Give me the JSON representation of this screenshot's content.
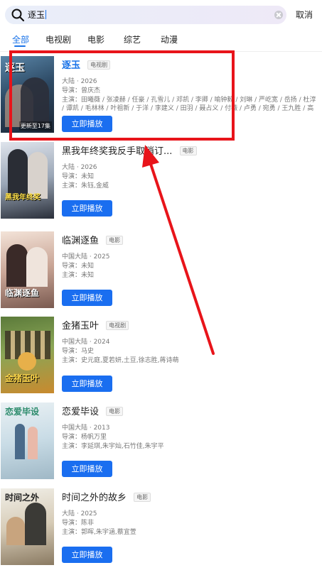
{
  "search": {
    "query": "逐玉",
    "cancel_label": "取消"
  },
  "tabs": [
    {
      "label": "全部"
    },
    {
      "label": "电视剧"
    },
    {
      "label": "电影"
    },
    {
      "label": "综艺"
    },
    {
      "label": "动漫"
    }
  ],
  "results": [
    {
      "title": "逐玉",
      "tag": "电视剧",
      "region_year": "大陆 · 2026",
      "director": "导演：曾庆杰",
      "cast": "主演：田曦薇 / 张凌赫 / 任豪 / 孔雪儿 / 邓凯 / 李卿 / 喻钟毅 / 刘琳 / 严屹宽 / 岳扬 / 杜淳 / 谭凯 / 毛林林 / 叶祖新 / 于洋 / 李建义 / 田羽 / 聂占义 / 付薇 / 卢勇 / 宛勇 / 王九胜 / 高卿…",
      "poster_title": "逐玉",
      "poster_badge": "更新至17集",
      "play_label": "立即播放"
    },
    {
      "title": "黑我年终奖我反手取消订...",
      "tag": "电影",
      "region_year": "大陆 · 2026",
      "director": "导演：未知",
      "cast": "主演：朱钰,金威",
      "poster_title": "黑我年终奖",
      "poster_badge": "",
      "play_label": "立即播放"
    },
    {
      "title": "临渊逐鱼",
      "tag": "电影",
      "region_year": "中国大陆 · 2025",
      "director": "导演：未知",
      "cast": "主演：未知",
      "poster_title": "临渊逐鱼",
      "poster_badge": "",
      "play_label": "立即播放"
    },
    {
      "title": "金猪玉叶",
      "tag": "电视剧",
      "region_year": "中国大陆 · 2024",
      "director": "导演：马史",
      "cast": "主演：史元庭,夏若妍,土豆,徐志胜,蒋诗萌",
      "poster_title": "金猪玉叶",
      "poster_badge": "",
      "play_label": "立即播放"
    },
    {
      "title": "恋爱毕设",
      "tag": "电影",
      "region_year": "中国大陆 · 2013",
      "director": "导演：杨帆万里",
      "cast": "主演：李延琪,朱宇灿,石竹佳,朱宇平",
      "poster_title": "恋爱毕设",
      "poster_badge": "",
      "play_label": "立即播放"
    },
    {
      "title": "时间之外的故乡",
      "tag": "电影",
      "region_year": "大陆 · 2025",
      "director": "导演：陈非",
      "cast": "主演：郭晖,朱宇涵,蔡宜萱",
      "poster_title": "时间之外",
      "poster_badge": "",
      "play_label": "立即播放"
    }
  ],
  "colors": {
    "accent": "#1a73e8",
    "play_button": "#1a6ef0",
    "annotation": "#e8141a"
  }
}
